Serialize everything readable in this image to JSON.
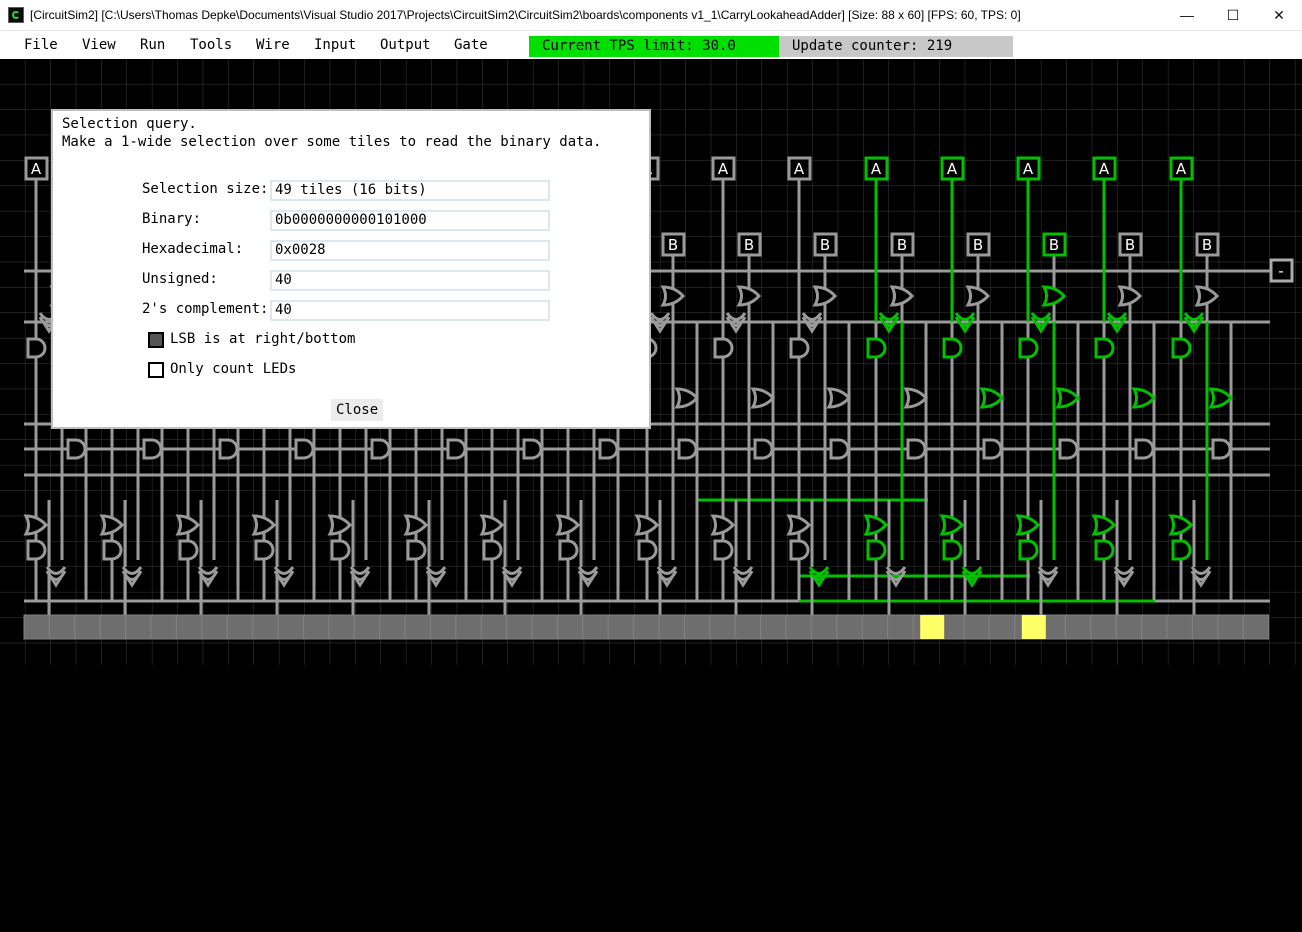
{
  "window": {
    "title": "[CircuitSim2] [C:\\Users\\Thomas Depke\\Documents\\Visual Studio 2017\\Projects\\CircuitSim2\\CircuitSim2\\boards\\components v1_1\\CarryLookaheadAdder] [Size: 88 x 60] [FPS: 60, TPS: 0]",
    "minimize": "—",
    "maximize": "☐",
    "close": "✕"
  },
  "menu": [
    "File",
    "View",
    "Run",
    "Tools",
    "Wire",
    "Input",
    "Output",
    "Gate"
  ],
  "status": {
    "tps_label": "Current TPS limit: 30.0",
    "tps_color": "#00e000",
    "update_label": "Update counter: 219",
    "update_color": "#c8c8c8"
  },
  "board": {
    "input_a_label": "A",
    "input_b_label": "B",
    "minus_label": "-",
    "wire_on_color": "#00c000",
    "wire_off_color": "#9a9a9a",
    "led_on_color": "#ffff66",
    "output_lit_bits": [
      5,
      3
    ]
  },
  "dialog": {
    "line1": "Selection query.",
    "line2": "Make a 1-wide selection over some tiles to read the binary data.",
    "fields": [
      {
        "label": "Selection size:",
        "value": "49 tiles (16 bits)"
      },
      {
        "label": "Binary:",
        "value": "0b0000000000101000"
      },
      {
        "label": "Hexadecimal:",
        "value": "0x0028"
      },
      {
        "label": "Unsigned:",
        "value": "40"
      },
      {
        "label": "2's complement:",
        "value": "40"
      }
    ],
    "lsb_checkbox": {
      "label": "LSB is at right/bottom",
      "checked": true
    },
    "led_checkbox": {
      "label": "Only count LEDs",
      "checked": false
    },
    "close_label": "Close"
  }
}
